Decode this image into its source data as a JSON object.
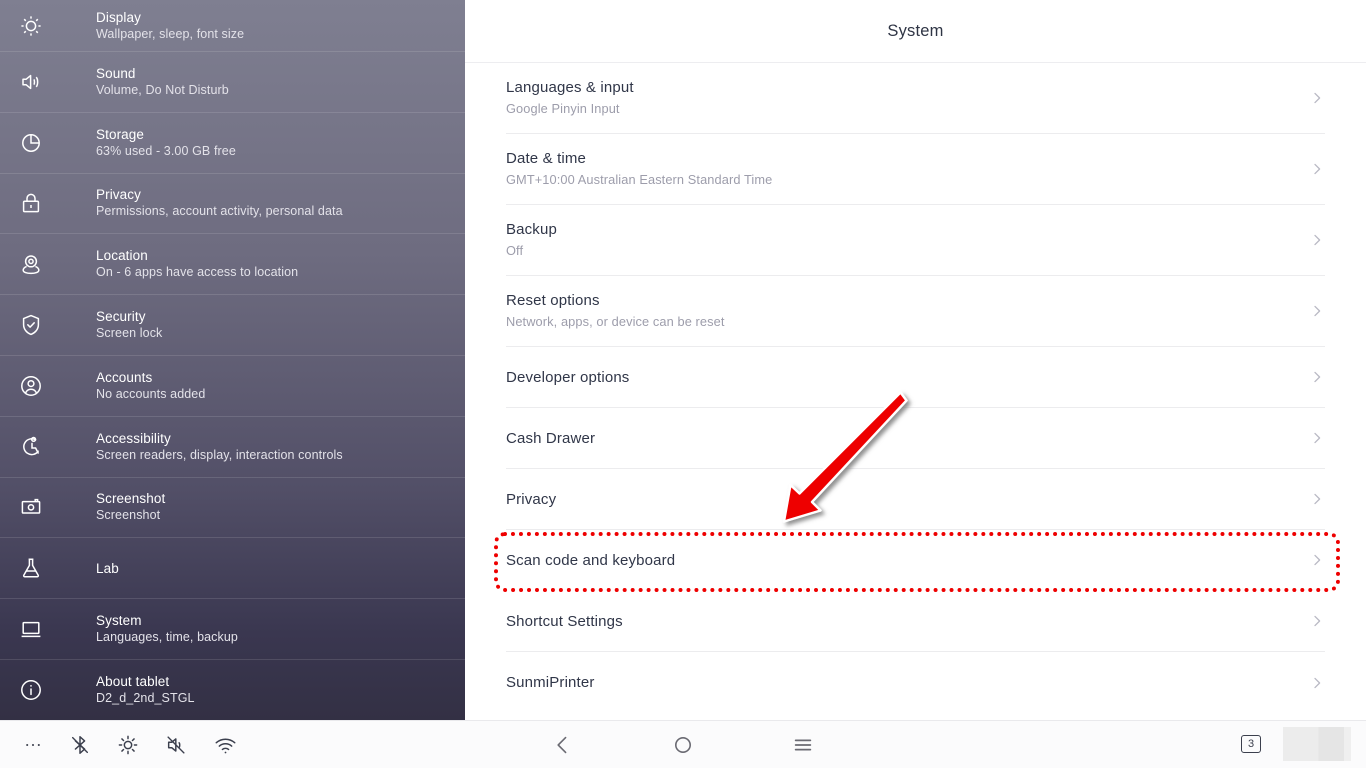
{
  "sidebar": {
    "items": [
      {
        "icon": "brightness-icon",
        "title": "Display",
        "subtitle": "Wallpaper, sleep, font size"
      },
      {
        "icon": "sound-icon",
        "title": "Sound",
        "subtitle": "Volume, Do Not Disturb"
      },
      {
        "icon": "storage-icon",
        "title": "Storage",
        "subtitle": "63% used - 3.00 GB free"
      },
      {
        "icon": "lock-icon",
        "title": "Privacy",
        "subtitle": "Permissions, account activity, personal data"
      },
      {
        "icon": "location-pin-icon",
        "title": "Location",
        "subtitle": "On - 6 apps have access to location"
      },
      {
        "icon": "shield-icon",
        "title": "Security",
        "subtitle": "Screen lock"
      },
      {
        "icon": "account-icon",
        "title": "Accounts",
        "subtitle": "No accounts added"
      },
      {
        "icon": "accessibility-icon",
        "title": "Accessibility",
        "subtitle": "Screen readers, display, interaction controls"
      },
      {
        "icon": "camera-icon",
        "title": "Screenshot",
        "subtitle": "Screenshot"
      },
      {
        "icon": "flask-icon",
        "title": "Lab",
        "subtitle": ""
      },
      {
        "icon": "monitor-icon",
        "title": "System",
        "subtitle": "Languages, time, backup"
      },
      {
        "icon": "info-icon",
        "title": "About tablet",
        "subtitle": "D2_d_2nd_STGL"
      }
    ]
  },
  "main": {
    "header_title": "System",
    "rows": [
      {
        "title": "Languages & input",
        "subtitle": "Google Pinyin Input"
      },
      {
        "title": "Date & time",
        "subtitle": "GMT+10:00 Australian Eastern Standard Time"
      },
      {
        "title": "Backup",
        "subtitle": "Off"
      },
      {
        "title": "Reset options",
        "subtitle": "Network, apps, or device can be reset"
      },
      {
        "title": "Developer options",
        "subtitle": ""
      },
      {
        "title": "Cash Drawer",
        "subtitle": ""
      },
      {
        "title": "Privacy",
        "subtitle": ""
      },
      {
        "title": "Scan code and keyboard",
        "subtitle": ""
      },
      {
        "title": "Shortcut Settings",
        "subtitle": ""
      },
      {
        "title": "SunmiPrinter",
        "subtitle": ""
      }
    ]
  },
  "annotation": {
    "highlight_color": "#ee0000",
    "highlight_target": "Scan code and keyboard",
    "arrow_color": "#ee0000"
  },
  "navbar": {
    "status_icons": [
      "overflow-dots-icon",
      "bluetooth-off-icon",
      "brightness-icon",
      "volume-mute-icon",
      "wifi-icon"
    ],
    "back_label": "back-icon",
    "home_label": "home-icon",
    "recents_label": "menu-icon",
    "recent_count": "3"
  }
}
